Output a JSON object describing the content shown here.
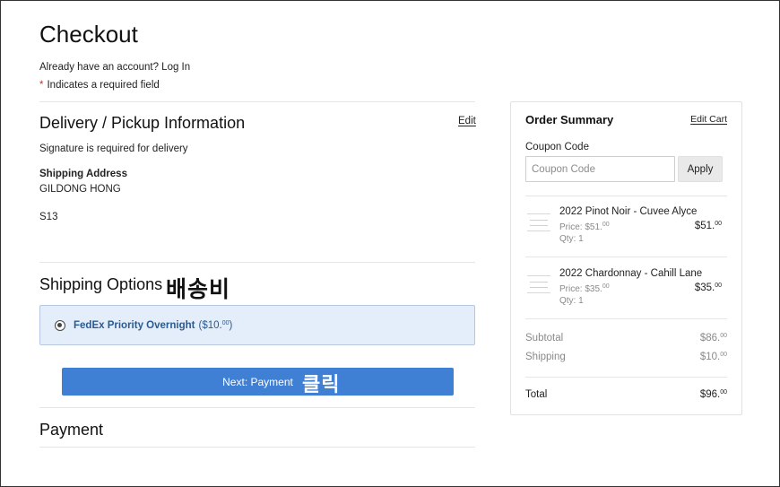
{
  "page": {
    "title": "Checkout",
    "account_prompt": "Already have an account? Log In",
    "required_star": "*",
    "required_note": "Indicates a required field"
  },
  "delivery": {
    "title": "Delivery / Pickup Information",
    "edit_label": "Edit",
    "signature_note": "Signature is required for delivery",
    "address_label": "Shipping Address",
    "name": "GILDONG HONG",
    "line": "S13"
  },
  "shipping": {
    "title": "Shipping Options",
    "annotation": "배송비",
    "option_label": "FedEx Priority Overnight",
    "option_price_open": "($10.",
    "option_price_cents": "00",
    "option_price_close": ")"
  },
  "next_button": {
    "label": "Next: Payment",
    "annotation": "클릭"
  },
  "payment": {
    "title": "Payment"
  },
  "summary": {
    "title": "Order Summary",
    "edit_cart": "Edit Cart",
    "coupon_label": "Coupon Code",
    "coupon_placeholder": "Coupon Code",
    "coupon_value": "",
    "apply_label": "Apply",
    "items": [
      {
        "name": "2022 Pinot Noir - Cuvee Alyce",
        "price": "Price: $51.",
        "price_cents": "00",
        "qty": "Qty: 1",
        "total": "$51.",
        "total_cents": "00"
      },
      {
        "name": "2022 Chardonnay - Cahill Lane",
        "price": "Price: $35.",
        "price_cents": "00",
        "qty": "Qty: 1",
        "total": "$35.",
        "total_cents": "00"
      }
    ],
    "subtotal_label": "Subtotal",
    "subtotal_value": "$86.",
    "subtotal_cents": "00",
    "shipping_label": "Shipping",
    "shipping_value": "$10.",
    "shipping_cents": "00",
    "total_label": "Total",
    "total_value": "$96.",
    "total_cents": "00"
  },
  "colors": {
    "primary_button": "#3f7fd4",
    "selected_option_bg": "#e4eefb",
    "option_text": "#2c5a8e"
  }
}
